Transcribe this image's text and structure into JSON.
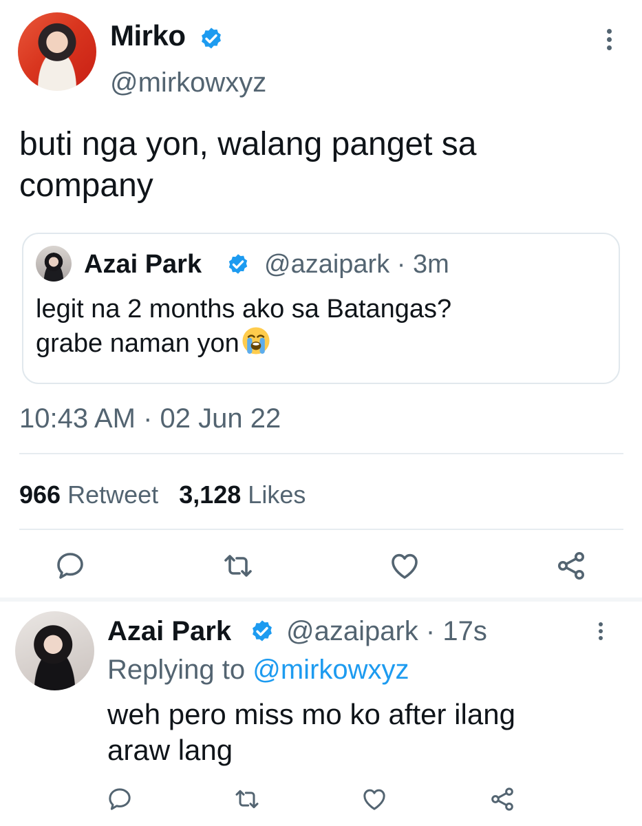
{
  "main_tweet": {
    "author_name": "Mirko",
    "author_handle": "@mirkowxyz",
    "text_line1": "buti nga yon, walang panget sa",
    "text_line2": "company",
    "timestamp": "10:43 AM · 02 Jun 22",
    "retweet_count": "966",
    "retweet_label": "Retweet",
    "likes_count": "3,128",
    "likes_label": "Likes"
  },
  "quoted_tweet": {
    "author_name": "Azai Park",
    "meta": "@azaipark · 3m",
    "text_line1": "legit na 2 months ako sa Batangas?",
    "text_line2": "grabe naman yon"
  },
  "reply_tweet": {
    "author_name": "Azai Park",
    "meta": "@azaipark · 17s",
    "replying_label": "Replying to",
    "replying_handle": "@mirkowxyz",
    "text_line1": "weh pero miss mo ko after ilang",
    "text_line2": "araw lang"
  },
  "icons": {
    "reply": "reply-icon",
    "retweet": "retweet-icon",
    "like": "heart-icon",
    "share": "share-icon",
    "verified": "verified-badge-icon",
    "more": "more-options-icon",
    "emoji": "loudly-crying-face-emoji"
  },
  "colors": {
    "accent": "#1d9bf0",
    "secondary_text": "#536471",
    "primary_text": "#0f1419",
    "divider": "#e6ecf0"
  }
}
